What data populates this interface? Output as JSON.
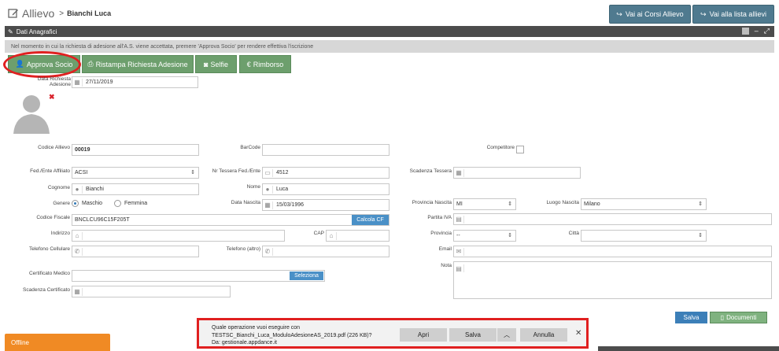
{
  "header": {
    "section": "Allievo",
    "separator": ">",
    "student_name": "Bianchi Luca",
    "btn_courses": "Vai ai Corsi Allievo",
    "btn_list": "Vai alla lista allievi"
  },
  "panel": {
    "title": "Dati Anagrafici"
  },
  "notice": "Nel momento in cui la richiesta di adesione all'A.S. viene accettata, premere 'Approva Socio' per rendere effettiva l'iscrizione",
  "actions": {
    "approve": "Approva Socio",
    "reprint": "Ristampa Richiesta Adesione",
    "selfie": "Selfie",
    "refund": "Rimborso"
  },
  "form": {
    "request_date_label": "Data Richiesta Adesione",
    "request_date": "27/11/2019",
    "code_label": "Codice Allievo",
    "code": "00019",
    "barcode_label": "BarCode",
    "barcode": "",
    "competitor_label": "Competitore",
    "fed_label": "Fed./Ente Affiliato",
    "fed": "ACSI",
    "card_label": "Nr Tessera Fed./Ente",
    "card": "4512",
    "card_expiry_label": "Scadenza Tessera",
    "card_expiry": "",
    "surname_label": "Cognome",
    "surname": "Bianchi",
    "firstname_label": "Nome",
    "firstname": "Luca",
    "gender_label": "Genere",
    "male": "Maschio",
    "female": "Femmina",
    "birthdate_label": "Data Nascita",
    "birthdate": "15/03/1996",
    "birth_province_label": "Provincia Nascita",
    "birth_province": "MI",
    "birth_place_label": "Luogo Nascita",
    "birth_place": "Milano",
    "tax_code_label": "Codice Fiscale",
    "tax_code": "BNCLCU96C15F205T",
    "calc_cf": "Calcola CF",
    "vat_label": "Partita IVA",
    "address_label": "Indirizzo",
    "cap_label": "CAP",
    "province_label": "Provincia",
    "province": "--",
    "city_label": "Città",
    "mobile_label": "Telefono Cellulare",
    "phone_other_label": "Telefono (altro)",
    "email_label": "Email",
    "medical_label": "Certificato Medico",
    "select_btn": "Seleziona",
    "note_label": "Nota",
    "cert_expiry_label": "Scadenza Certificato"
  },
  "footer_buttons": {
    "save": "Salva",
    "documents": "Documenti"
  },
  "download": {
    "question": "Quale operazione vuoi eseguire con",
    "file": "TESTSC_Bianchi_Luca_ModuloAdesioneAS_2019.pdf (226 KB)?",
    "source": "Da: gestionale.appdance.it",
    "open": "Apri",
    "save": "Salva",
    "cancel": "Annulla"
  },
  "status": {
    "offline": "Offline"
  },
  "colors": {
    "header_button": "#4f7a8f",
    "green_button": "#6d9f6d",
    "blue_button": "#4a90c7",
    "highlight": "#e02020",
    "offline": "#f08a24"
  }
}
